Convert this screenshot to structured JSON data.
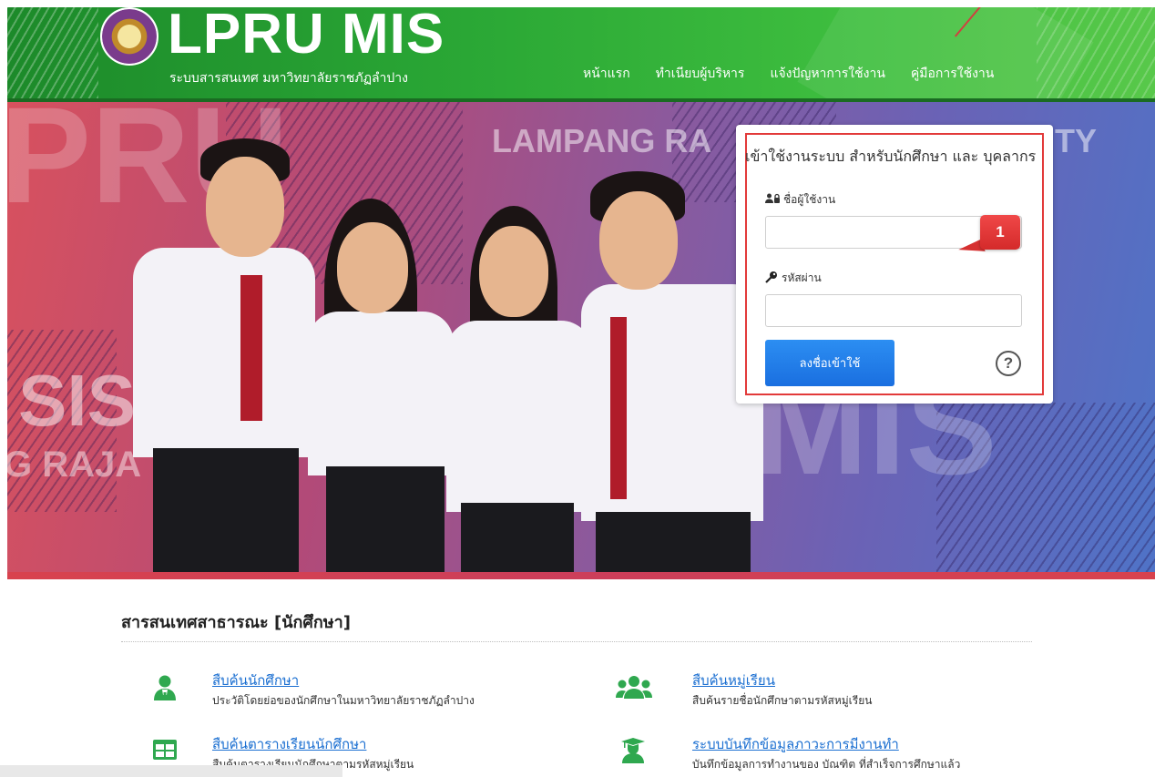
{
  "header": {
    "brand_title": "LPRU MIS",
    "brand_subtitle": "ระบบสารสนเทศ มหาวิทยาลัยราชภัฏลำปาง",
    "nav": [
      "หน้าแรก",
      "ทำเนียบผู้บริหาร",
      "แจ้งปัญหาการใช้งาน",
      "คู่มือการใช้งาน"
    ],
    "color": "#2aa735"
  },
  "hero": {
    "background_text": [
      "PRU",
      "LAMPANG RA",
      "TY",
      "SIS",
      "G RAJA",
      "MIS"
    ]
  },
  "login": {
    "title": "เข้าใช้งานระบบ สำหรับนักศึกษา และ บุคลากร",
    "username_label": "ชื่อผู้ใช้งาน",
    "username_value": "",
    "password_label": "รหัสผ่าน",
    "password_value": "",
    "button_label": "ลงชื่อเข้าใช้",
    "help_icon": "?",
    "callout_number": "1",
    "button_color": "#1a6fe0",
    "highlight_color": "#e23a3a"
  },
  "public_info": {
    "section_title": "สารสนเทศสาธารณะ [นักศึกษา]",
    "services": [
      {
        "icon": "student-icon",
        "title": "สืบค้นนักศึกษา",
        "desc": "ประวัติโดยย่อของนักศึกษาในมหาวิทยาลัยราชภัฏลำปาง"
      },
      {
        "icon": "group-icon",
        "title": "สืบค้นหมู่เรียน",
        "desc": "สืบค้นรายชื่อนักศึกษาตามรหัสหมู่เรียน"
      },
      {
        "icon": "table-icon",
        "title": "สืบค้นตารางเรียนนักศึกษา",
        "desc": "สืบค้นตารางเรียนนักศึกษาตามรหัสหมู่เรียน"
      },
      {
        "icon": "graduate-icon",
        "title": "ระบบบันทึกข้อมูลภาวะการมีงานทำ",
        "desc": "บันทึกข้อมูลการทำงานของ บัณฑิต ที่สำเร็จการศึกษาแล้ว"
      }
    ],
    "accent_color": "#2fa84f",
    "link_color": "#1b6fd1"
  }
}
